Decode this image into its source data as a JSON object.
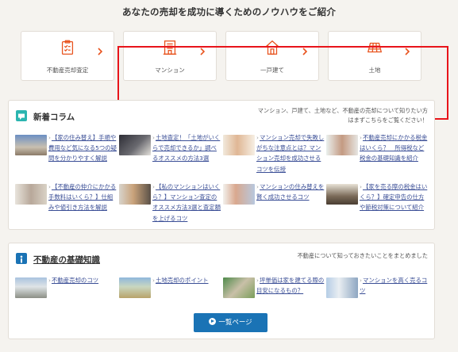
{
  "heading": "あなたの売却を成功に導くためのノウハウをご紹介",
  "cards": [
    {
      "label": "不動産売却査定",
      "icon": "clipboard-checklist-icon"
    },
    {
      "label": "マンション",
      "icon": "building-icon"
    },
    {
      "label": "一戸建て",
      "icon": "house-icon"
    },
    {
      "label": "土地",
      "icon": "land-grid-icon"
    }
  ],
  "colors": {
    "accent_orange": "#e8531e",
    "highlight_red": "#e8141a",
    "panel1_icon": "#2bb5b0",
    "panel2_icon": "#1a73b5",
    "link": "#3a4e96",
    "button": "#1a73b5"
  },
  "new_column": {
    "title": "新着コラム",
    "icon": "speech-bubble-icon",
    "description": "マンション、戸建て、土地など、不動産の売却について知りたい方はまずこちらをご覧ください！",
    "articles": [
      {
        "text": "【家の住み替え】手順や費用など気になる5つの疑問を分かりやすく解説"
      },
      {
        "text": "土地査定！「土地がいくらで売却できるか」調べるオススメの方法3選"
      },
      {
        "text": "マンション売却で失敗しがちな注意点とは？マンション売却を成功させるコツを伝授"
      },
      {
        "text": "不動産売却にかかる税金はいくら？　所得税など税金の基礎知識を紹介"
      },
      {
        "text": "【不動産の仲介にかかる手数料はいくら？】仕組みや値引き方法を解説"
      },
      {
        "text": "【私のマンションはいくら？】マンション査定のオススメ方法3選と査定額を上げるコツ"
      },
      {
        "text": "マンションの住み替えを賢く成功させるコツ"
      },
      {
        "text": "【家を売る際の税金はいくら？】確定申告の仕方や節税対策について紹介"
      }
    ]
  },
  "basics": {
    "title": "不動産の基礎知識",
    "icon": "info-icon",
    "description": "不動産について知っておきたいことをまとめました",
    "articles": [
      {
        "text": "不動産売却のコツ"
      },
      {
        "text": "土地売却のポイント"
      },
      {
        "text": "坪単価は家を建てる際の目安になるもの？"
      },
      {
        "text": "マンションを高く売るコツ"
      }
    ],
    "more_button": "一覧ページ"
  }
}
